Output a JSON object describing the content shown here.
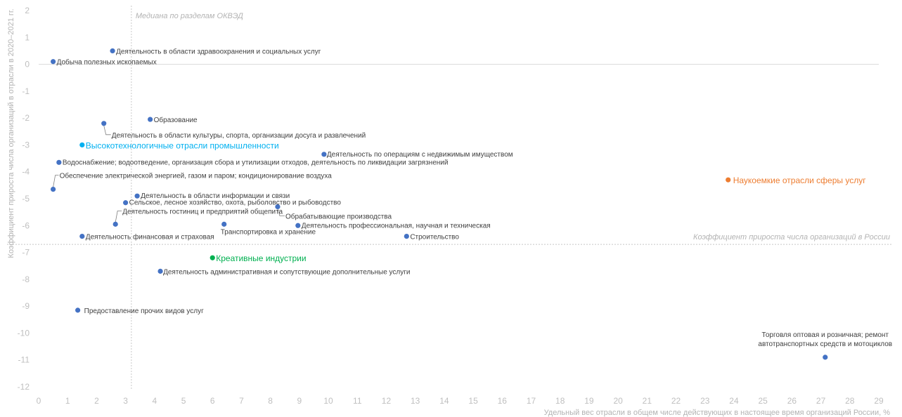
{
  "chart_data": {
    "type": "scatter",
    "xlabel": "Удельный вес отрасли в общем числе действующих в настоящее время организаций России, %",
    "ylabel": "Коэффициент прироста числа организаций в отрасли в 2020–2021 гг.",
    "xlim": [
      0,
      29
    ],
    "ylim": [
      -12,
      2
    ],
    "x_ticks": [
      0,
      1,
      2,
      3,
      4,
      5,
      6,
      7,
      8,
      9,
      10,
      11,
      12,
      13,
      14,
      15,
      16,
      17,
      18,
      19,
      20,
      21,
      22,
      23,
      24,
      25,
      26,
      27,
      28,
      29
    ],
    "y_ticks": [
      2,
      1,
      0,
      -1,
      -2,
      -3,
      -4,
      -5,
      -6,
      -7,
      -8,
      -9,
      -10,
      -11,
      -12
    ],
    "grid": false,
    "reference_lines": {
      "median_x": 3.2,
      "median_label": "Медиана по разделам ОКВЭД",
      "russia_y": -6.7,
      "russia_label": "Коэффициент прироста числа организаций в России"
    },
    "colors": {
      "industry": "#4472c4",
      "hightech": "#00b0f0",
      "knowledge": "#ed7d31",
      "creative": "#00b050"
    },
    "points": [
      {
        "label": "Добыча полезных ископаемых",
        "x": 0.5,
        "y": 0.1,
        "group": "industry"
      },
      {
        "label": "Деятельность в области здравоохранения и социальных услуг",
        "x": 2.55,
        "y": 0.5,
        "group": "industry"
      },
      {
        "label": "Образование",
        "x": 3.85,
        "y": -2.05,
        "group": "industry"
      },
      {
        "label": "Деятельность в области культуры, спорта, организации досуга и развлечений",
        "x": 2.25,
        "y": -2.2,
        "group": "industry"
      },
      {
        "label": "Высокотехнологичные отрасли промышленности",
        "x": 1.5,
        "y": -3.0,
        "group": "hightech"
      },
      {
        "label": "Деятельность по операциям с недвижимым имуществом",
        "x": 9.85,
        "y": -3.35,
        "group": "industry"
      },
      {
        "label": "Водоснабжение; водоотведение, организация сбора и утилизации отходов, деятельность по ликвидации загрязнений",
        "x": 0.7,
        "y": -3.65,
        "group": "industry"
      },
      {
        "label": "Обеспечение электрической энергией, газом и паром; кондиционирование воздуха",
        "x": 0.5,
        "y": -4.65,
        "group": "industry"
      },
      {
        "label": "Деятельность в области информации и связи",
        "x": 3.4,
        "y": -4.9,
        "group": "industry"
      },
      {
        "label": "Сельское, лесное хозяйство, охота, рыболовство и рыбоводство",
        "x": 3.0,
        "y": -5.15,
        "group": "industry"
      },
      {
        "label": "Обрабатывающие производства",
        "x": 8.25,
        "y": -5.3,
        "group": "industry"
      },
      {
        "label": "Деятельность гостиниц и предприятий общепита",
        "x": 2.65,
        "y": -5.95,
        "group": "industry"
      },
      {
        "label": "Транспортировка и хранение",
        "x": 6.4,
        "y": -5.95,
        "group": "industry"
      },
      {
        "label": "Деятельность профессиональная, научная и техническая",
        "x": 8.95,
        "y": -6.0,
        "group": "industry"
      },
      {
        "label": "Деятельность финансовая и страховая",
        "x": 1.5,
        "y": -6.4,
        "group": "industry"
      },
      {
        "label": "Строительство",
        "x": 12.7,
        "y": -6.4,
        "group": "industry"
      },
      {
        "label": "Креативные индустрии",
        "x": 6.0,
        "y": -7.2,
        "group": "creative"
      },
      {
        "label": "Деятельность административная и сопутствующие дополнительные услуги",
        "x": 4.2,
        "y": -7.7,
        "group": "industry"
      },
      {
        "label": "Предоставление прочих видов услуг",
        "x": 1.35,
        "y": -9.15,
        "group": "industry"
      },
      {
        "label": "Наукоемкие отрасли сферы услуг",
        "x": 23.8,
        "y": -4.3,
        "group": "knowledge"
      },
      {
        "label_lines": [
          "Торговля оптовая и розничная; ремонт",
          "автотранспортных средств и мотоциклов"
        ],
        "x": 27.15,
        "y": -10.9,
        "group": "industry"
      }
    ]
  }
}
